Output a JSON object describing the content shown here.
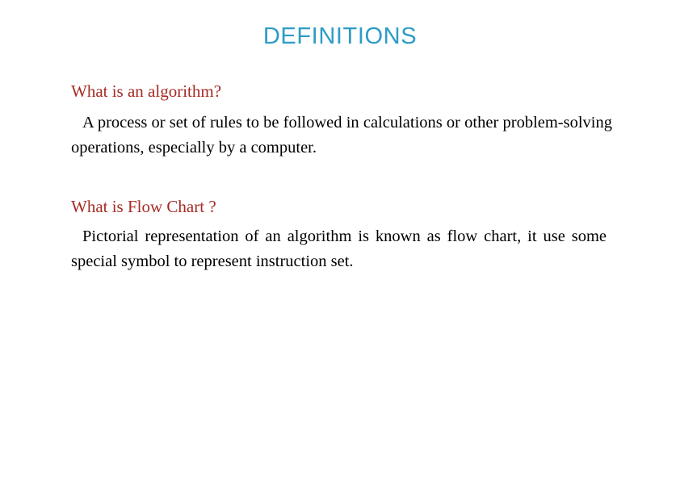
{
  "slide": {
    "title": "DEFINITIONS",
    "title_color": "#2e9cc6",
    "heading_color": "#a62b24",
    "body_color": "#000000",
    "background_color": "#ffffff",
    "sections": [
      {
        "heading": "What is an  algorithm?",
        "body": "A  process or  set of  rules  to be  followed  in  calculations or  other  problem-solving  operations,  especially  by  a computer."
      },
      {
        "heading": "What is Flow Chart  ?",
        "body": "Pictorial  representation  of  an  algorithm  is  known  as flow  chart,  it  use  some  special  symbol  to  represent instruction set."
      }
    ]
  }
}
